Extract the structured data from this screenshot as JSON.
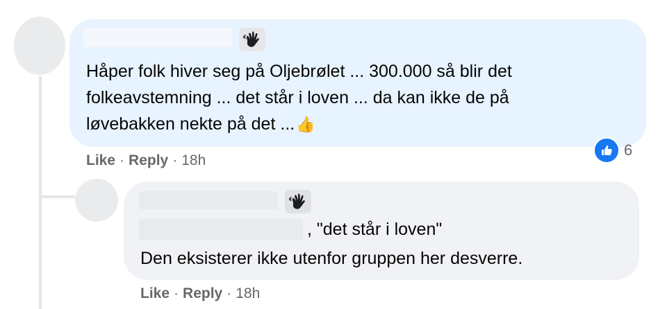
{
  "comment": {
    "text_lines": [
      "Håper folk hiver seg på Oljebrølet ... 300.000 så blir det",
      "folkeavstemning ... det står i loven ... da kan ikke de på",
      "løvebakken nekte på det ..."
    ],
    "thumbs_emoji": "👍",
    "bubble_color": "#e7f3ff",
    "actions": {
      "like": "Like",
      "reply": "Reply",
      "time": "18h",
      "separator": "·"
    },
    "reaction_count": "6",
    "reaction_color": "#1877f2"
  },
  "reply": {
    "line1": ", \"det står i loven\"",
    "line2": "Den eksisterer ikke utenfor gruppen her desverre.",
    "bubble_color": "#f0f2f5",
    "actions": {
      "like": "Like",
      "reply": "Reply",
      "time": "18h",
      "separator": "·"
    }
  }
}
